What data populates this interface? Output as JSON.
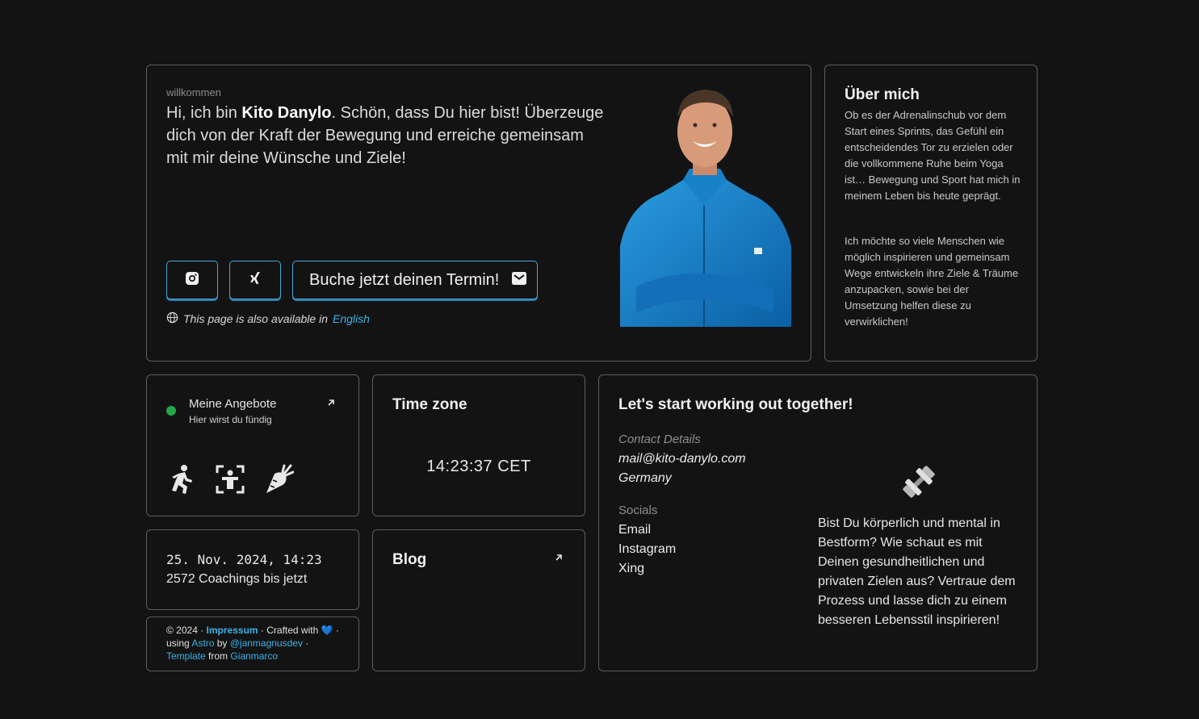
{
  "hero": {
    "eyebrow": "willkommen",
    "greeting_pre": "Hi, ich bin ",
    "name": "Kito Danylo",
    "greeting_post": ". Schön, dass Du hier bist! Überzeuge dich von der Kraft der Bewegung und erreiche gemeinsam mit mir deine Wünsche und Ziele!",
    "book_label": "Buche jetzt deinen Termin!",
    "lang_text": "This page is also available in",
    "lang_link": "English",
    "icons": {
      "instagram": "instagram-icon",
      "xing": "xing-icon",
      "mail": "envelope-icon",
      "globe": "globe-icon"
    }
  },
  "about": {
    "title": "Über mich",
    "p1": "Ob es der Adrenalinschub vor dem Start eines Sprints, das Gefühl ein entscheidendes Tor zu erzielen oder die vollkommene Ruhe beim Yoga ist… Bewegung und Sport hat mich in meinem Leben bis heute geprägt.",
    "p2": "Ich möchte so viele Menschen wie möglich inspirieren und gemeinsam Wege entwickeln ihre Ziele & Träume anzupacken, sowie bei der Umsetzung helfen diese zu verwirklichen!"
  },
  "offers": {
    "title": "Meine Angebote",
    "subtitle": "Hier wirst du fündig",
    "status_color": "#22a94a",
    "icons": [
      "running-icon",
      "fitness-scan-icon",
      "carrot-icon"
    ]
  },
  "timezone": {
    "title": "Time zone",
    "time": "14:23:37 CET"
  },
  "contact": {
    "title": "Let's start working out together!",
    "details_label": "Contact Details",
    "email": "mail@kito-danylo.com",
    "country": "Germany",
    "socials_label": "Socials",
    "socials": [
      "Email",
      "Instagram",
      "Xing"
    ],
    "pitch": "Bist Du körperlich und mental in Bestform? Wie schaut es mit Deinen gesundheitlichen und privaten Zielen aus? Vertraue dem Prozess und lasse dich zu einem besseren Lebensstil inspirieren!"
  },
  "stats": {
    "datetime": "25. Nov. 2024, 14:23",
    "coachings": "2572 Coachings bis jetzt"
  },
  "blog": {
    "title": "Blog"
  },
  "footer": {
    "copyright": "© 2024 · ",
    "impressum": "Impressum",
    "crafted": " · Crafted with ",
    "heart": "💙",
    "using": " using ",
    "astro": "Astro",
    "by": " by ",
    "author": "@janmagnusdev",
    "dot": " · ",
    "template": "Template",
    "from": " from ",
    "gianmarco": "Gianmarco"
  },
  "colors": {
    "accent": "#3db2e6",
    "background": "#131314",
    "border": "#5d5d60"
  }
}
